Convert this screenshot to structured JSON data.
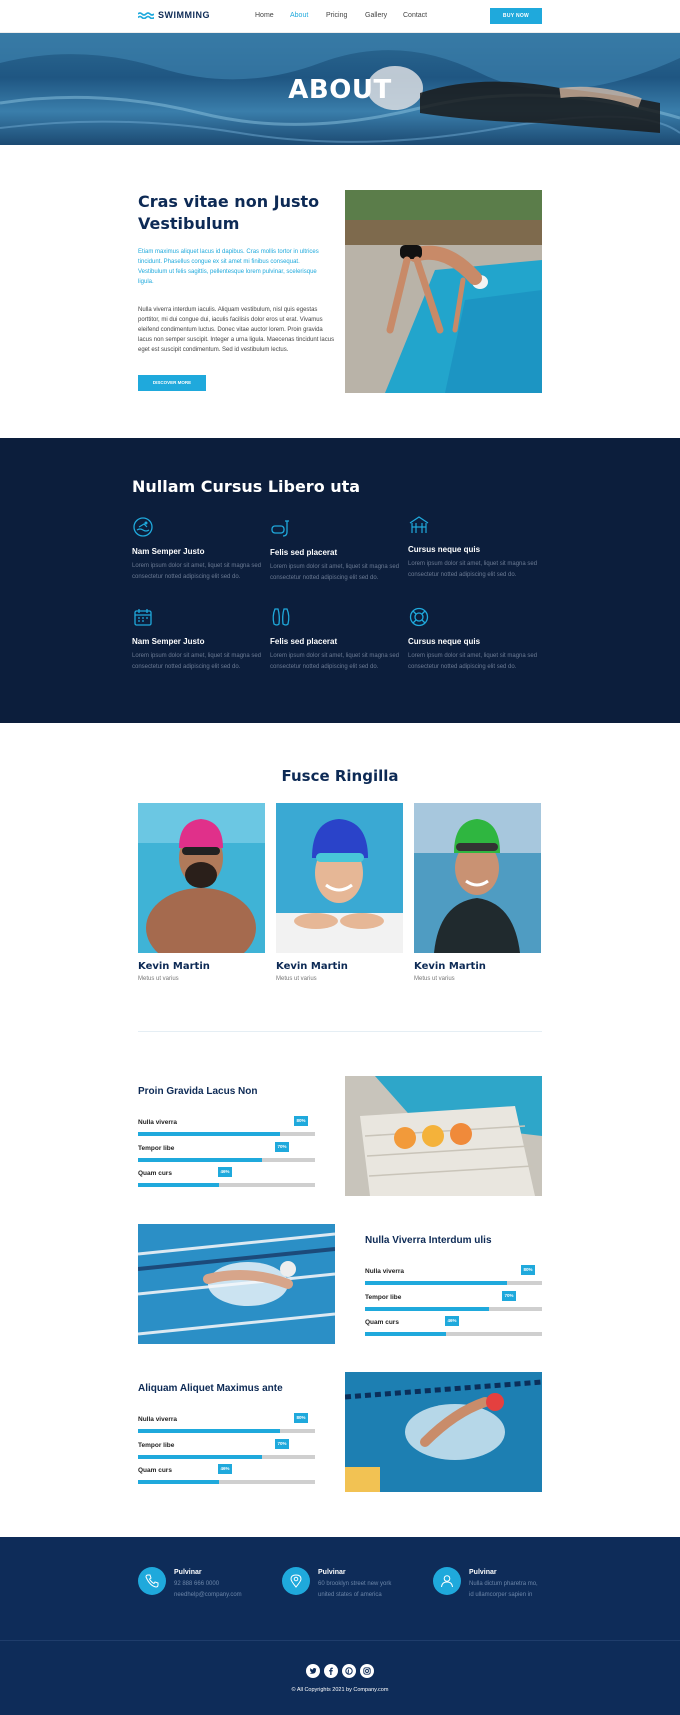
{
  "nav": {
    "logo": "SWIMMING",
    "links": [
      "Home",
      "About",
      "Pricing",
      "Gallery",
      "Contact"
    ],
    "active_link": "About",
    "buy_button": "BUY NOW"
  },
  "hero": {
    "title": "ABOUT"
  },
  "about": {
    "title": "Cras vitae non Justo Vestibulum",
    "lead": "Etiam maximus aliquet lacus id dapibus. Cras mollis tortor in ultrices tincidunt. Phasellus congue ex sit amet mi finibus consequat. Vestibulum ut felis sagittis, pellentesque lorem pulvinar, scelerisque ligula.",
    "body": "Nulla viverra interdum iaculis. Aliquam vestibulum, nisl quis egestas porttitor, mi dui congue dui, iaculis facilisis dolor eros ut erat. Vivamus eleifend condimentum luctus. Donec vitae auctor lorem. Proin gravida lacus non semper suscipit. Integer a urna ligula. Maecenas tincidunt lacus eget est suscipit condimentum. Sed id vestibulum lectus.",
    "button": "DISCOVER MORE"
  },
  "features": {
    "title": "Nullam Cursus Libero uta",
    "items": [
      {
        "icon": "swimmer-icon",
        "name": "Nam Semper Justo",
        "text": "Lorem ipsum dolor sit amet, liquet sit magna sed consectetur notted adipiscing elit sed do."
      },
      {
        "icon": "snorkel-icon",
        "name": "Felis sed placerat",
        "text": "Lorem ipsum dolor sit amet, liquet sit magna sed consectetur notted adipiscing elit sed do."
      },
      {
        "icon": "pool-house-icon",
        "name": "Cursus neque quis",
        "text": "Lorem ipsum dolor sit amet, liquet sit magna sed consectetur notted adipiscing elit sed do."
      },
      {
        "icon": "calendar-icon",
        "name": "Nam Semper Justo",
        "text": "Lorem ipsum dolor sit amet, liquet sit magna sed consectetur notted adipiscing elit sed do."
      },
      {
        "icon": "flippers-icon",
        "name": "Felis sed placerat",
        "text": "Lorem ipsum dolor sit amet, liquet sit magna sed consectetur notted adipiscing elit sed do."
      },
      {
        "icon": "lifebuoy-icon",
        "name": "Cursus neque quis",
        "text": "Lorem ipsum dolor sit amet, liquet sit magna sed consectetur notted adipiscing elit sed do."
      }
    ]
  },
  "team": {
    "title": "Fusce Ringilla",
    "members": [
      {
        "name": "Kevin Martin",
        "role": "Metus ut varius",
        "cap": "#e0308a"
      },
      {
        "name": "Kevin Martin",
        "role": "Metus ut varius",
        "cap": "#2a43c9"
      },
      {
        "name": "Kevin Martin",
        "role": "Metus ut varius",
        "cap": "#2fb640"
      }
    ]
  },
  "skills": [
    {
      "title": "Proin Gravida Lacus Non",
      "bars": [
        {
          "label": "Nulla viverra",
          "value": 80,
          "text": "80%"
        },
        {
          "label": "Tempor libe",
          "value": 70,
          "text": "70%"
        },
        {
          "label": "Quam curs",
          "value": 46,
          "text": "46%"
        }
      ]
    },
    {
      "title": "Nulla Viverra Interdum ulis",
      "bars": [
        {
          "label": "Nulla viverra",
          "value": 80,
          "text": "80%"
        },
        {
          "label": "Tempor libe",
          "value": 70,
          "text": "70%"
        },
        {
          "label": "Quam curs",
          "value": 46,
          "text": "46%"
        }
      ]
    },
    {
      "title": "Aliquam Aliquet Maximus ante",
      "bars": [
        {
          "label": "Nulla viverra",
          "value": 80,
          "text": "80%"
        },
        {
          "label": "Tempor libe",
          "value": 70,
          "text": "70%"
        },
        {
          "label": "Quam curs",
          "value": 46,
          "text": "46%"
        }
      ]
    }
  ],
  "footer": {
    "contacts": [
      {
        "icon": "phone-icon",
        "title": "Pulvinar",
        "lines": [
          "92 888 666 0000",
          "needhelp@company.com"
        ]
      },
      {
        "icon": "location-pin-icon",
        "title": "Pulvinar",
        "lines": [
          "60 brooklyn street new york",
          "united states of america"
        ]
      },
      {
        "icon": "user-icon",
        "title": "Pulvinar",
        "lines": [
          "Nulla dictum pharetra mo,",
          "id ullamcorper sapien in"
        ]
      }
    ],
    "socials": [
      "twitter-icon",
      "facebook-icon",
      "pinterest-icon",
      "instagram-icon"
    ],
    "copyright": "© All Copyrights 2021 by Company.com"
  },
  "colors": {
    "accent": "#1fa9dc",
    "navy": "#0d2a55",
    "dark_section": "#0c1e3c",
    "footer": "#0e2c59"
  }
}
